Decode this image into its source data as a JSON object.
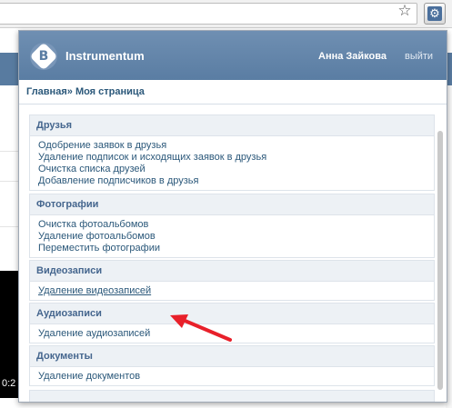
{
  "popup": {
    "app_title": "Instrumentum",
    "user_name": "Анна Зайкова",
    "logout_label": "выйти",
    "breadcrumb": {
      "home": "Главная",
      "separator": "»",
      "current": "Моя страница"
    },
    "sections": [
      {
        "title": "Друзья",
        "items": [
          "Одобрение заявок в друзья",
          "Удаление подписок и исходящих заявок в друзья",
          "Очистка списка друзей",
          "Добавление подписчиков в друзья"
        ]
      },
      {
        "title": "Фотографии",
        "items": [
          "Очистка фотоальбомов",
          "Удаление фотоальбомов",
          "Переместить фотографии"
        ]
      },
      {
        "title": "Видеозаписи",
        "items": [
          "Удаление видеозаписей"
        ]
      },
      {
        "title": "Аудиозаписи",
        "items": [
          "Удаление аудиозаписей"
        ]
      },
      {
        "title": "Документы",
        "items": [
          "Удаление документов"
        ]
      }
    ]
  },
  "background": {
    "video_time": "0:2"
  },
  "icons": {
    "extension": "gear-icon",
    "bookmark": "star-icon",
    "logo": "vk-logo-icon",
    "annotation": "red-arrow-icon"
  },
  "colors": {
    "header": "#5a7da3",
    "link": "#2b587a",
    "section_header_bg": "#edf1f5",
    "arrow": "#e8202a"
  }
}
